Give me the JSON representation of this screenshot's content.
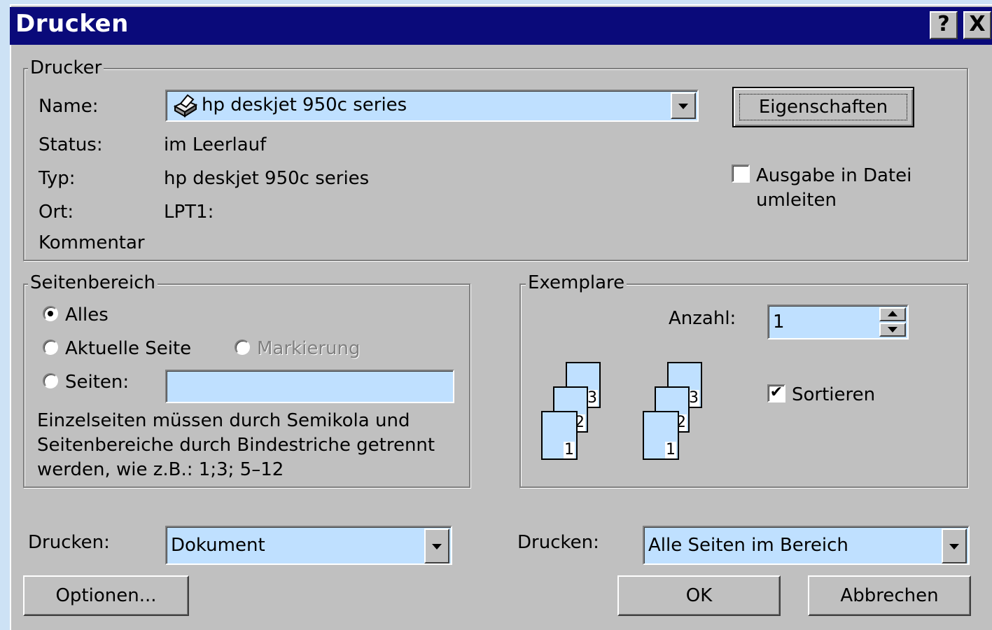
{
  "window": {
    "title": "Drucken",
    "help_button": "?",
    "close_button": "X"
  },
  "printer": {
    "group_label": "Drucker",
    "name_label": "Name:",
    "name_value": "hp deskjet 950c series",
    "properties_button": "Eigenschaften",
    "status_label": "Status:",
    "status_value": "im Leerlauf",
    "type_label": "Typ:",
    "type_value": "hp deskjet 950c series",
    "location_label": "Ort:",
    "location_value": "LPT1:",
    "comment_label": "Kommentar",
    "print_to_file_line1": "Ausgabe in Datei",
    "print_to_file_line2": "umleiten",
    "print_to_file_checked": false
  },
  "page_range": {
    "group_label": "Seitenbereich",
    "all_label": "Alles",
    "current_page_label": "Aktuelle Seite",
    "selection_label": "Markierung",
    "pages_label": "Seiten:",
    "pages_value": "",
    "selected": "all",
    "hint_line1": "Einzelseiten müssen durch Semikola und",
    "hint_line2": "Seitenbereiche durch Bindestriche getrennt",
    "hint_line3": "werden, wie z.B.: 1;3; 5–12"
  },
  "copies": {
    "group_label": "Exemplare",
    "count_label": "Anzahl:",
    "count_value": "1",
    "collate_label": "Sortieren",
    "collate_checked": true,
    "page_numbers": [
      "1",
      "2",
      "3"
    ]
  },
  "print_what": {
    "label": "Drucken:",
    "value": "Dokument"
  },
  "print_pages": {
    "label": "Drucken:",
    "value": "Alle Seiten im Bereich"
  },
  "buttons": {
    "options": "Optionen...",
    "ok": "OK",
    "cancel": "Abbrechen"
  },
  "colors": {
    "title_bar": "#0a0a7a",
    "dialog_face": "#c0c0c0",
    "field_background": "#bfe0ff"
  }
}
